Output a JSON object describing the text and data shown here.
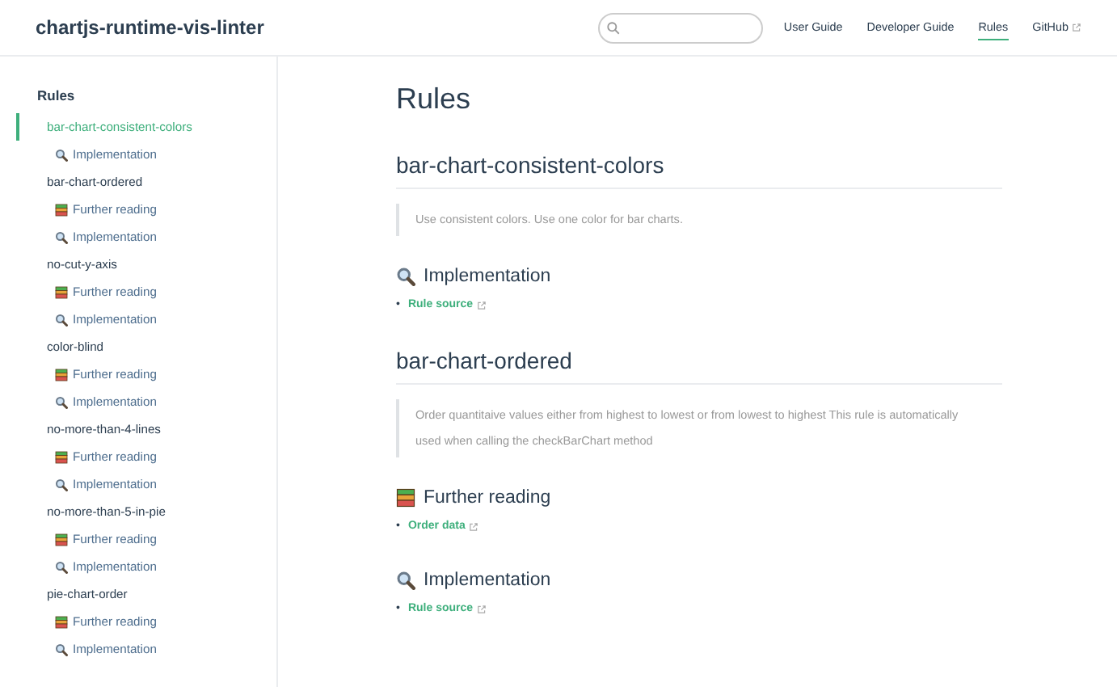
{
  "header": {
    "title": "chartjs-runtime-vis-linter",
    "nav": [
      {
        "label": "User Guide",
        "selected": false,
        "external": false
      },
      {
        "label": "Developer Guide",
        "selected": false,
        "external": false
      },
      {
        "label": "Rules",
        "selected": true,
        "external": false
      },
      {
        "label": "GitHub",
        "selected": false,
        "external": true
      }
    ]
  },
  "sidebar": {
    "title": "Rules",
    "items": [
      {
        "label": "bar-chart-consistent-colors",
        "selected": true,
        "children": [
          {
            "kind": "implementation",
            "label": "Implementation"
          }
        ]
      },
      {
        "label": "bar-chart-ordered",
        "selected": false,
        "children": [
          {
            "kind": "reading",
            "label": "Further reading"
          },
          {
            "kind": "implementation",
            "label": "Implementation"
          }
        ]
      },
      {
        "label": "no-cut-y-axis",
        "selected": false,
        "children": [
          {
            "kind": "reading",
            "label": "Further reading"
          },
          {
            "kind": "implementation",
            "label": "Implementation"
          }
        ]
      },
      {
        "label": "color-blind",
        "selected": false,
        "children": [
          {
            "kind": "reading",
            "label": "Further reading"
          },
          {
            "kind": "implementation",
            "label": "Implementation"
          }
        ]
      },
      {
        "label": "no-more-than-4-lines",
        "selected": false,
        "children": [
          {
            "kind": "reading",
            "label": "Further reading"
          },
          {
            "kind": "implementation",
            "label": "Implementation"
          }
        ]
      },
      {
        "label": "no-more-than-5-in-pie",
        "selected": false,
        "children": [
          {
            "kind": "reading",
            "label": "Further reading"
          },
          {
            "kind": "implementation",
            "label": "Implementation"
          }
        ]
      },
      {
        "label": "pie-chart-order",
        "selected": false,
        "children": [
          {
            "kind": "reading",
            "label": "Further reading"
          },
          {
            "kind": "implementation",
            "label": "Implementation"
          }
        ]
      }
    ]
  },
  "content": {
    "title": "Rules",
    "rules": [
      {
        "name": "bar-chart-consistent-colors",
        "description": "Use consistent colors. Use one color for bar charts.",
        "sections": [
          {
            "kind": "implementation",
            "heading": "Implementation",
            "links": [
              {
                "bullet": "•",
                "label": "Rule source"
              }
            ]
          }
        ]
      },
      {
        "name": "bar-chart-ordered",
        "description": "Order quantitaive values either from highest to lowest or from lowest to highest This rule is automatically used when calling the checkBarChart method",
        "sections": [
          {
            "kind": "reading",
            "heading": "Further reading",
            "links": [
              {
                "bullet": "•",
                "label": "Order data"
              }
            ]
          },
          {
            "kind": "implementation",
            "heading": "Implementation",
            "links": [
              {
                "bullet": "•",
                "label": "Rule source"
              }
            ]
          }
        ]
      }
    ]
  }
}
